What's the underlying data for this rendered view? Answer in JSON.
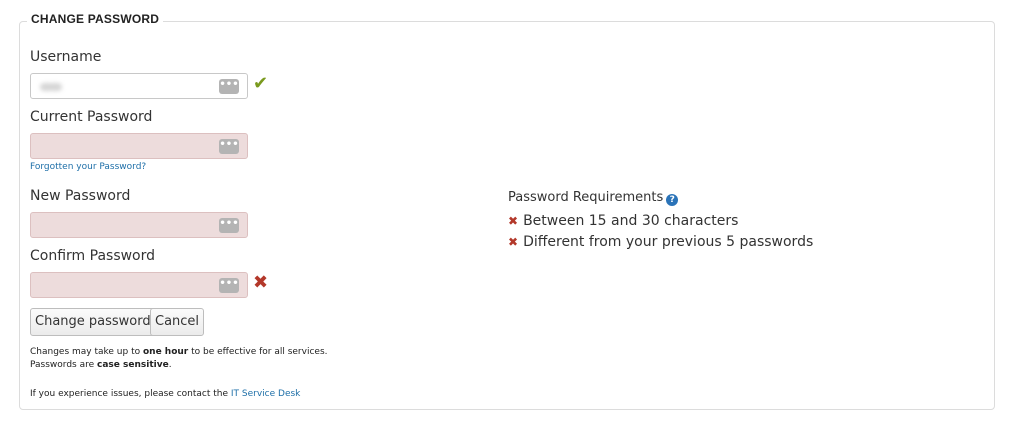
{
  "section": {
    "title": "CHANGE PASSWORD"
  },
  "username": {
    "label": "Username",
    "value_state": "valid"
  },
  "current_password": {
    "label": "Current Password",
    "forgot_link": "Forgotten your Password?"
  },
  "new_password": {
    "label": "New Password"
  },
  "confirm_password": {
    "label": "Confirm Password",
    "value_state": "invalid"
  },
  "requirements": {
    "title": "Password Requirements",
    "items": [
      {
        "text": "Between 15 and 30 characters",
        "met": false
      },
      {
        "text": "Different from your previous 5 passwords",
        "met": false
      }
    ]
  },
  "buttons": {
    "change": "Change password",
    "cancel": "Cancel"
  },
  "notes": {
    "line1_prefix": "Changes may take up to ",
    "line1_bold": "one hour",
    "line1_suffix": " to be effective for all services.",
    "line2_prefix": "Passwords are ",
    "line2_bold": "case sensitive",
    "line2_suffix": ".",
    "line3_prefix": "If you experience issues, please contact the ",
    "line3_link": "IT Service Desk"
  },
  "colors": {
    "valid": "#7a9a1e",
    "invalid": "#b3382a",
    "error_field_bg": "#eddcdc",
    "link": "#1e6fa8"
  },
  "icons": {
    "valid": "checkmark-icon",
    "invalid": "x-icon",
    "help": "question-circle-icon",
    "reveal": "ellipsis-icon"
  }
}
